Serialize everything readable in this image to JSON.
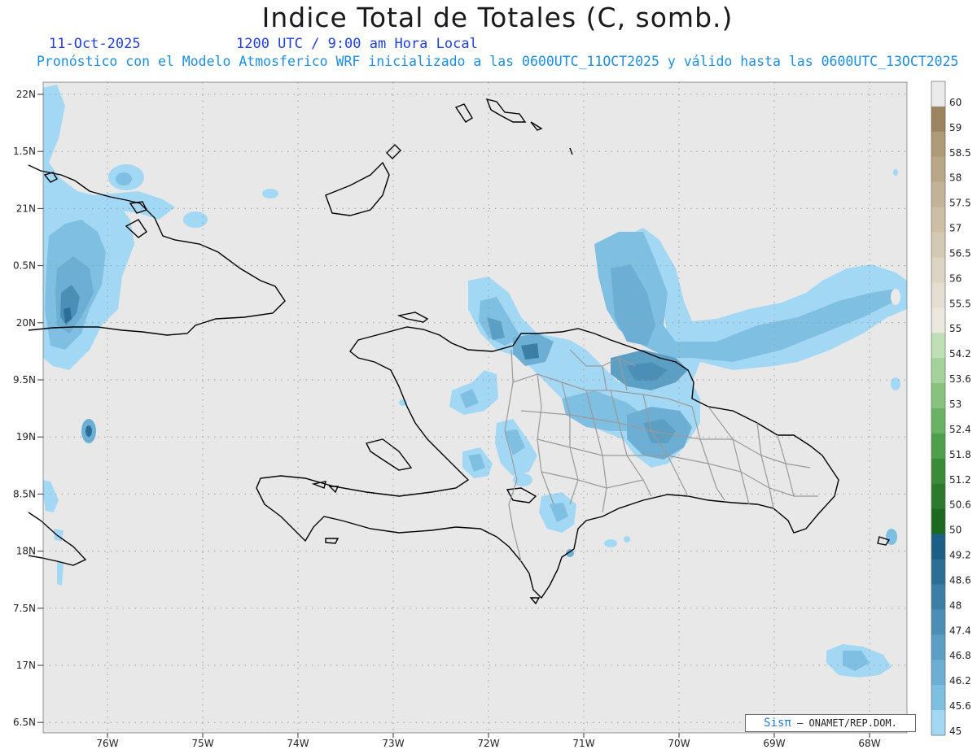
{
  "header": {
    "title": "Indice Total de Totales (C, somb.)",
    "date": "11-Oct-2025",
    "time": "1200 UTC / 9:00 am Hora Local",
    "subtitle": "Pronóstico con el Modelo Atmosferico WRF inicializado a las 0600UTC_11OCT2025 y válido hasta las  0600UTC_13OCT2025"
  },
  "map": {
    "lat_labels": [
      "22N",
      "1.5N",
      "21N",
      "0.5N",
      "20N",
      "9.5N",
      "19N",
      "8.5N",
      "18N",
      "7.5N",
      "17N",
      "6.5N"
    ],
    "lon_labels": [
      "76W",
      "75W",
      "74W",
      "73W",
      "72W",
      "71W",
      "70W",
      "69W",
      "68W"
    ],
    "background_color": "#e8e8e8",
    "coastline_color": "#000000",
    "province_border_color": "#999999"
  },
  "colorbar": {
    "labels": [
      "60",
      "59",
      "58.5",
      "58",
      "57.5",
      "57",
      "56.5",
      "56",
      "55.5",
      "55",
      "54.2",
      "53.6",
      "53",
      "52.4",
      "51.8",
      "51.2",
      "50.6",
      "50",
      "49.2",
      "48.6",
      "48",
      "47.4",
      "46.8",
      "46.2",
      "45.6",
      "45"
    ],
    "colors": [
      "#eaeaea",
      "#9a8560",
      "#ae9b77",
      "#b9a888",
      "#c4b497",
      "#cdbfa5",
      "#d5c9b3",
      "#ddd4c3",
      "#e4ddd0",
      "#ebe7dd",
      "#bfe0b4",
      "#a4d29a",
      "#87c27e",
      "#6ab264",
      "#4fa04b",
      "#3a8c38",
      "#2d7a2e",
      "#1c6a1f",
      "#1c5f86",
      "#2b6f97",
      "#3b7fa6",
      "#4b8fb6",
      "#5c9fc5",
      "#6dafd4",
      "#7fbfe2",
      "#a2d8f4"
    ]
  },
  "credit": {
    "logo_text": "Sisπ",
    "text": "– ONAMET/REP.DOM."
  }
}
